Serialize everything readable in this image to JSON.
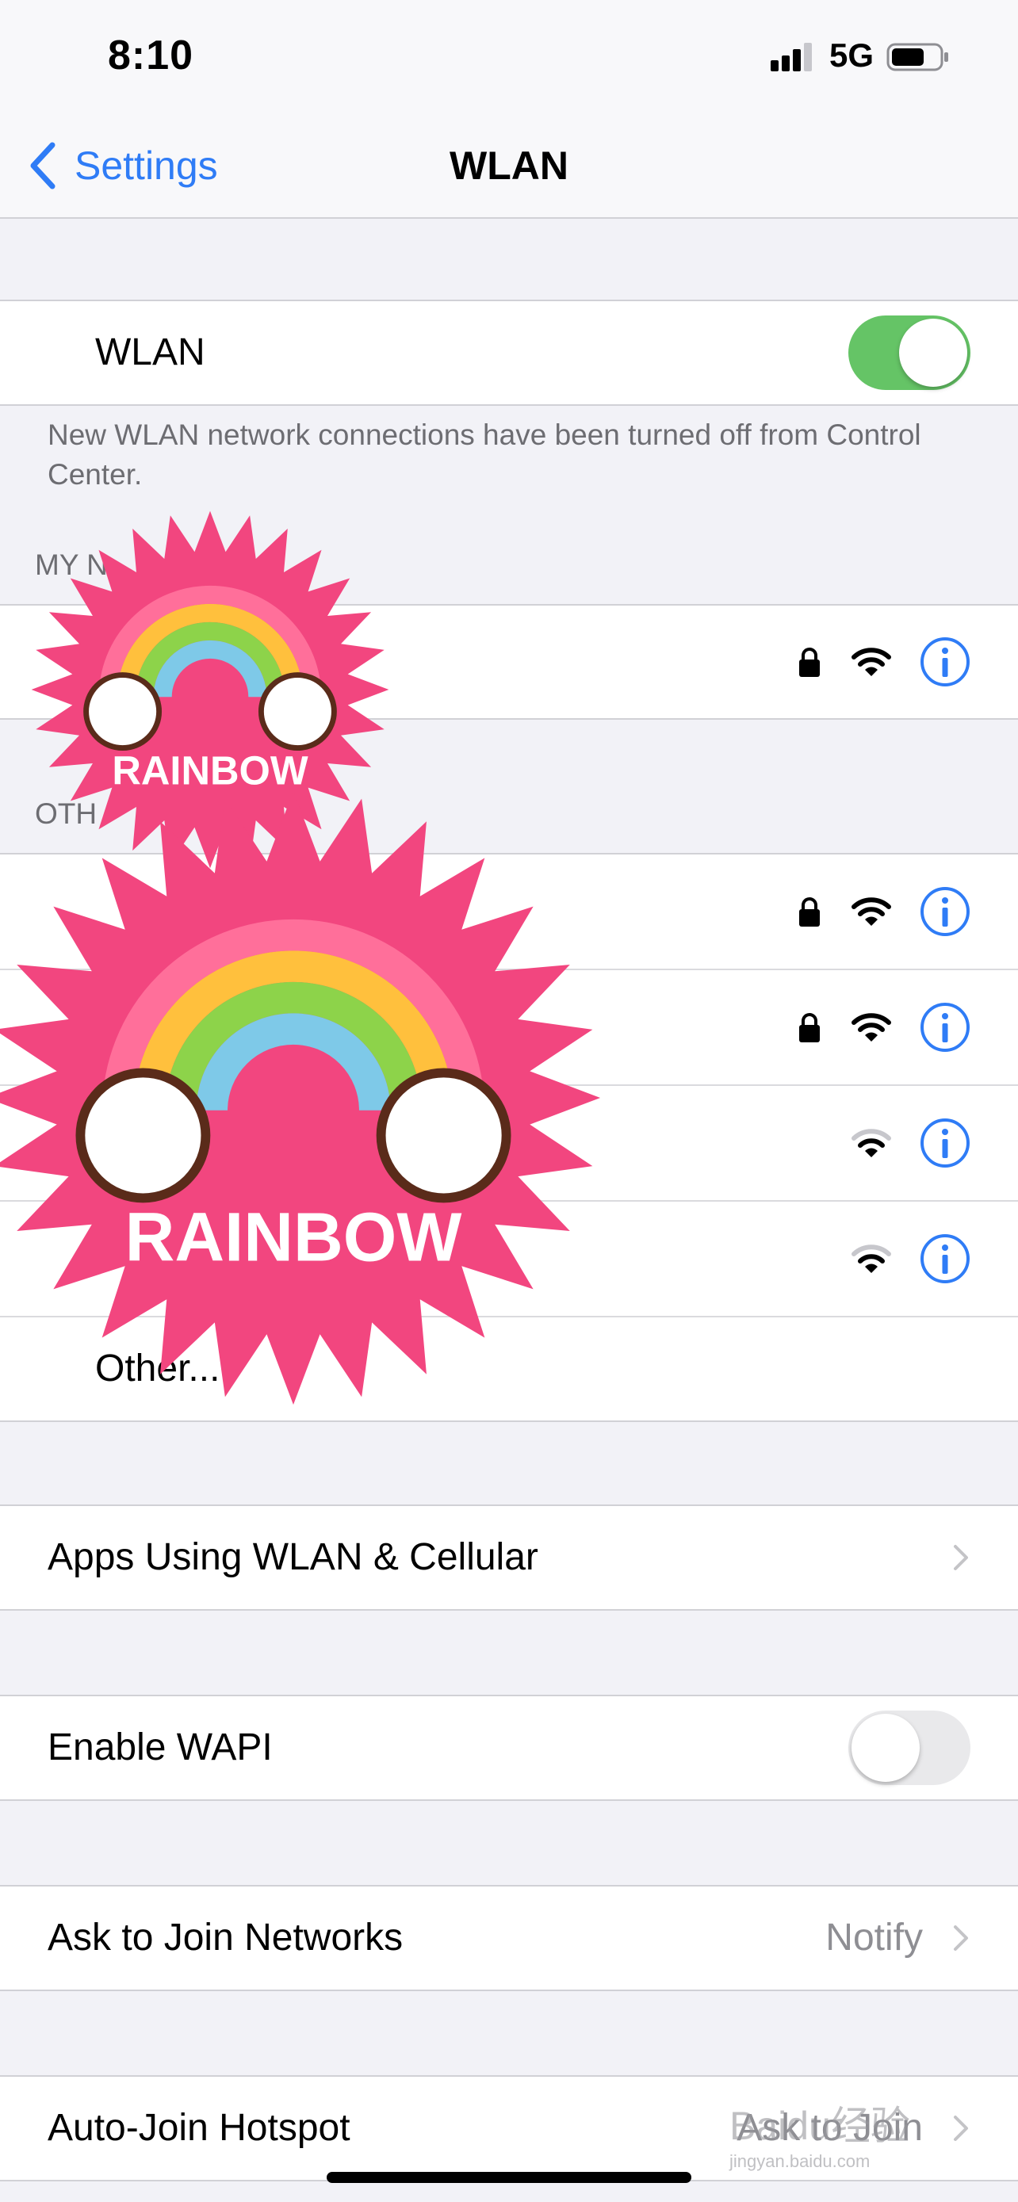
{
  "status_bar": {
    "time": "8:10",
    "network": "5G",
    "icons": [
      "cellular-signal-icon",
      "battery-icon"
    ]
  },
  "nav": {
    "back_label": "Settings",
    "title": "WLAN"
  },
  "wlan": {
    "label": "WLAN",
    "toggle_on": true,
    "footer_note": "New WLAN network connections have been turned off from Control Center."
  },
  "my_networks": {
    "header": "MY N",
    "items": [
      {
        "name": "",
        "secured": true
      }
    ]
  },
  "other_networks": {
    "header": "OTH",
    "items": [
      {
        "name": "",
        "secured": true
      },
      {
        "name": "",
        "secured": true
      },
      {
        "name": "",
        "secured": false
      },
      {
        "name": "",
        "secured": false
      }
    ],
    "other_label": "Other..."
  },
  "apps_using": {
    "label": "Apps Using WLAN & Cellular"
  },
  "wapi": {
    "label": "Enable WAPI",
    "toggle_on": false
  },
  "ask_to_join": {
    "label": "Ask to Join Networks",
    "value": "Notify"
  },
  "auto_join_hotspot": {
    "label": "Auto-Join Hotspot",
    "value": "Ask to Join"
  },
  "sticker": {
    "text": "RAINBOW"
  },
  "watermark": {
    "text": "Baidu经验",
    "sub": "jingyan.baidu.com"
  },
  "colors": {
    "accent": "#2f7cf6",
    "toggle_on": "#65c466",
    "sticker_pink": "#f2467f"
  }
}
